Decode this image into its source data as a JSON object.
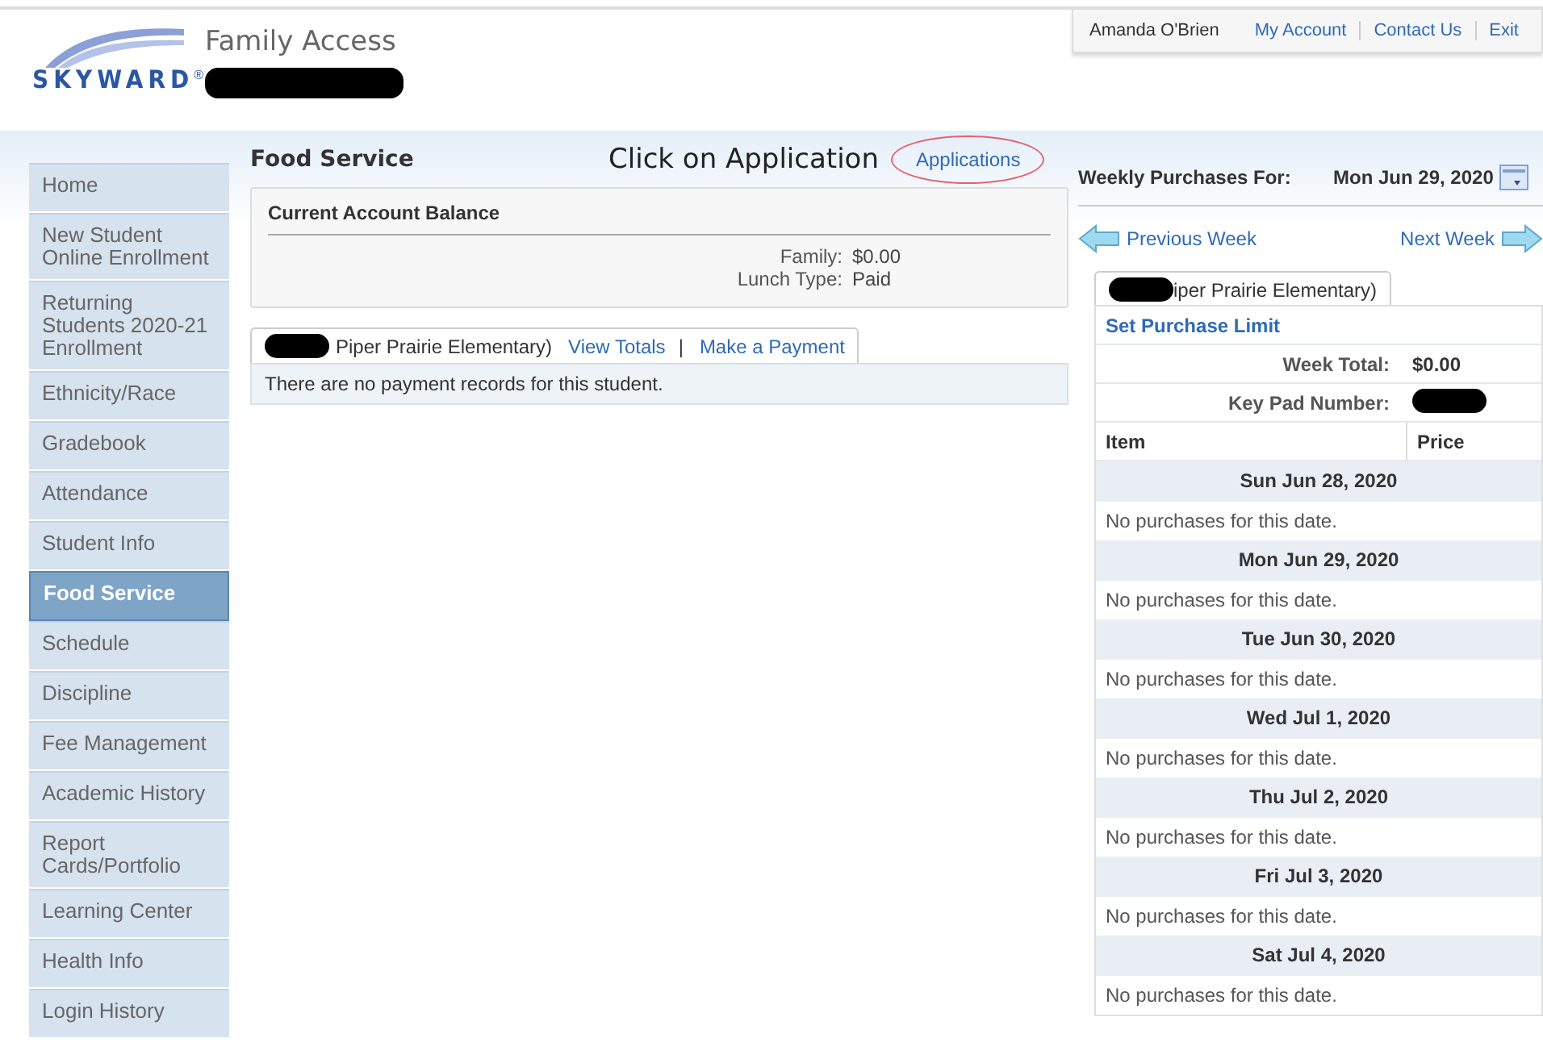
{
  "header": {
    "logo": "SKYWARD",
    "logo_mark": "®",
    "title": "Family Access"
  },
  "top_nav": [
    {
      "label": "Amanda O'Brien",
      "kind": "text"
    },
    {
      "label": "My Account",
      "kind": "link"
    },
    {
      "label": "Contact Us",
      "kind": "link"
    },
    {
      "label": "Exit",
      "kind": "link"
    }
  ],
  "sidebar": {
    "items": [
      {
        "label": "Home",
        "selected": false
      },
      {
        "label": "New Student Online Enrollment",
        "selected": false
      },
      {
        "label": "Returning Students 2020-21 Enrollment",
        "selected": false
      },
      {
        "label": "Ethnicity/Race",
        "selected": false
      },
      {
        "label": "Gradebook",
        "selected": false
      },
      {
        "label": "Attendance",
        "selected": false
      },
      {
        "label": "Student Info",
        "selected": false
      },
      {
        "label": "Food Service",
        "selected": true
      },
      {
        "label": "Schedule",
        "selected": false
      },
      {
        "label": "Discipline",
        "selected": false
      },
      {
        "label": "Fee Management",
        "selected": false
      },
      {
        "label": "Academic History",
        "selected": false
      },
      {
        "label": "Report Cards/Portfolio",
        "selected": false
      },
      {
        "label": "Learning Center",
        "selected": false
      },
      {
        "label": "Health Info",
        "selected": false
      },
      {
        "label": "Login History",
        "selected": false
      }
    ]
  },
  "main": {
    "title": "Food Service",
    "annotation": "Click on Application",
    "applications_link": "Applications",
    "balance": {
      "title": "Current Account Balance",
      "rows": [
        {
          "label": "Family:",
          "value": "$0.00"
        },
        {
          "label": "Lunch Type:",
          "value": "Paid"
        }
      ]
    },
    "student_tab": {
      "school": "Piper Prairie Elementary)",
      "links": [
        "View Totals",
        "Make a Payment"
      ],
      "separator": "|",
      "message": "There are no payment records for this student."
    }
  },
  "weekly": {
    "label": "Weekly Purchases For:",
    "date": "Mon Jun 29, 2020",
    "previous": "Previous Week",
    "next": "Next Week",
    "tab": "iper Prairie Elementary)",
    "set_limit": "Set Purchase Limit",
    "week_total_label": "Week Total:",
    "week_total": "$0.00",
    "keypad_label": "Key Pad Number:",
    "columns": [
      "Item",
      "Price"
    ],
    "days": [
      {
        "date": "Sun Jun 28, 2020",
        "message": "No purchases for this date."
      },
      {
        "date": "Mon Jun 29, 2020",
        "message": "No purchases for this date."
      },
      {
        "date": "Tue Jun 30, 2020",
        "message": "No purchases for this date."
      },
      {
        "date": "Wed Jul 1, 2020",
        "message": "No purchases for this date."
      },
      {
        "date": "Thu Jul 2, 2020",
        "message": "No purchases for this date."
      },
      {
        "date": "Fri Jul 3, 2020",
        "message": "No purchases for this date."
      },
      {
        "date": "Sat Jul 4, 2020",
        "message": "No purchases for this date."
      }
    ]
  }
}
